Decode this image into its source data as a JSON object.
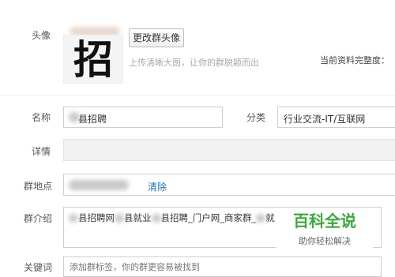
{
  "avatar": {
    "label": "头像",
    "image_char": "招",
    "change_button": "更改群头像",
    "hint": "上传清晰大图，让你的群脱颖而出",
    "profile_completeness_label": "当前资料完整度："
  },
  "form": {
    "name": {
      "label": "名称",
      "value": "县招聘"
    },
    "category": {
      "label": "分类",
      "value": "行业交流-IT/互联网"
    },
    "details": {
      "label": "详情",
      "value": ""
    },
    "location": {
      "label": "群地点",
      "clear_link": "清除"
    },
    "intro": {
      "label": "群介绍",
      "seg1": "县招聘网",
      "seg2": "县就业",
      "seg3": "县招聘_门户网_商家群_",
      "seg4": "就"
    },
    "keywords": {
      "label": "关键词",
      "placeholder": "添加群标签，你的群更容易被找到"
    }
  },
  "watermark": {
    "title": "百科全说",
    "subtitle": "助你轻松解决"
  },
  "colors": {
    "link": "#1a73c9",
    "watermark_title": "#3da83d",
    "watermark_bg": "#ffffff"
  }
}
